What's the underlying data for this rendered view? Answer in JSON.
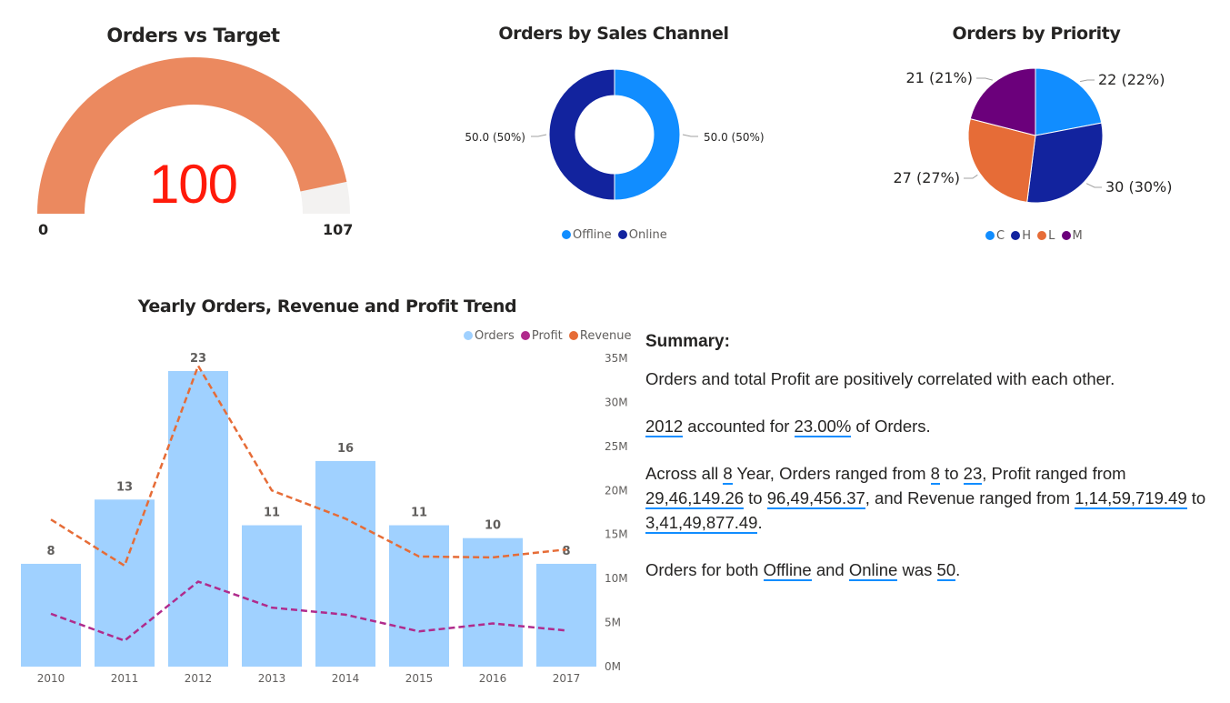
{
  "gauge": {
    "title": "Orders vs Target",
    "value": "100",
    "min": "0",
    "max": "107",
    "value_num": 100,
    "max_num": 107,
    "fill_color": "#eb895f",
    "track_color": "#f3f2f1",
    "value_color": "#ff1a0a"
  },
  "channel": {
    "title": "Orders by Sales Channel",
    "legend": [
      "Offline",
      "Online"
    ],
    "colors": [
      "#118dff",
      "#12239e"
    ],
    "labels": [
      "50.0 (50%)",
      "50.0 (50%)"
    ]
  },
  "priority": {
    "title": "Orders by Priority",
    "legend": [
      "C",
      "H",
      "L",
      "M"
    ],
    "colors": [
      "#118dff",
      "#12239e",
      "#e66c37",
      "#6b007b"
    ],
    "labels": [
      "22 (22%)",
      "30 (30%)",
      "27 (27%)",
      "21 (21%)"
    ]
  },
  "trend": {
    "title": "Yearly Orders, Revenue and Profit Trend",
    "legend": [
      "Orders",
      "Profit",
      "Revenue"
    ],
    "y_ticks": [
      "0M",
      "5M",
      "10M",
      "15M",
      "20M",
      "25M",
      "30M",
      "35M"
    ]
  },
  "summary": {
    "heading": "Summary:",
    "p1": "Orders and total Profit are positively correlated with each other.",
    "p2": {
      "year": "2012",
      "t1": " accounted for ",
      "pct": "23.00%",
      "t2": " of Orders."
    },
    "p3": {
      "t1": "Across all ",
      "n": "8",
      "t2": " Year, Orders ranged from ",
      "omin": "8",
      "t3": " to ",
      "omax": "23",
      "t4": ", Profit ranged from ",
      "pmin": "29,46,149.26",
      "t5": " to ",
      "pmax": "96,49,456.37",
      "t6": ", and Revenue ranged from ",
      "rmin": "1,14,59,719.49",
      "t7": " to ",
      "rmax": "3,41,49,877.49",
      "t8": "."
    },
    "p4": {
      "t1": "Orders for both ",
      "a": "Offline",
      "t2": " and ",
      "b": "Online",
      "t3": " was ",
      "v": "50",
      "t4": "."
    }
  },
  "chart_data": [
    {
      "type": "gauge",
      "title": "Orders vs Target",
      "value": 100,
      "min": 0,
      "max": 107
    },
    {
      "type": "pie",
      "title": "Orders by Sales Channel",
      "donut": true,
      "categories": [
        "Offline",
        "Online"
      ],
      "values": [
        50,
        50
      ],
      "colors": [
        "#118dff",
        "#12239e"
      ],
      "legend": "bottom"
    },
    {
      "type": "pie",
      "title": "Orders by Priority",
      "categories": [
        "C",
        "H",
        "L",
        "M"
      ],
      "values": [
        22,
        30,
        27,
        21
      ],
      "colors": [
        "#118dff",
        "#12239e",
        "#e66c37",
        "#6b007b"
      ],
      "legend": "bottom"
    },
    {
      "type": "bar",
      "title": "Yearly Orders, Revenue and Profit Trend",
      "categories": [
        "2010",
        "2011",
        "2012",
        "2013",
        "2014",
        "2015",
        "2016",
        "2017"
      ],
      "series": [
        {
          "name": "Orders",
          "type": "bar",
          "values": [
            8,
            13,
            23,
            11,
            16,
            11,
            10,
            8
          ],
          "color": "#a0d1ff"
        },
        {
          "name": "Profit",
          "type": "line",
          "axis": "right",
          "values": [
            6000000,
            2946149.26,
            9649456.37,
            6700000,
            5900000,
            4000000,
            4900000,
            4100000
          ],
          "color": "#b02b8c"
        },
        {
          "name": "Revenue",
          "type": "line",
          "axis": "right",
          "values": [
            16700000,
            11459719.49,
            34149877.49,
            20000000,
            16800000,
            12500000,
            12400000,
            13300000
          ],
          "color": "#e66c37"
        }
      ],
      "y_left_range": [
        0,
        23
      ],
      "y_right_range": [
        0,
        35000000
      ],
      "legend": "top-right",
      "grid": false
    }
  ]
}
